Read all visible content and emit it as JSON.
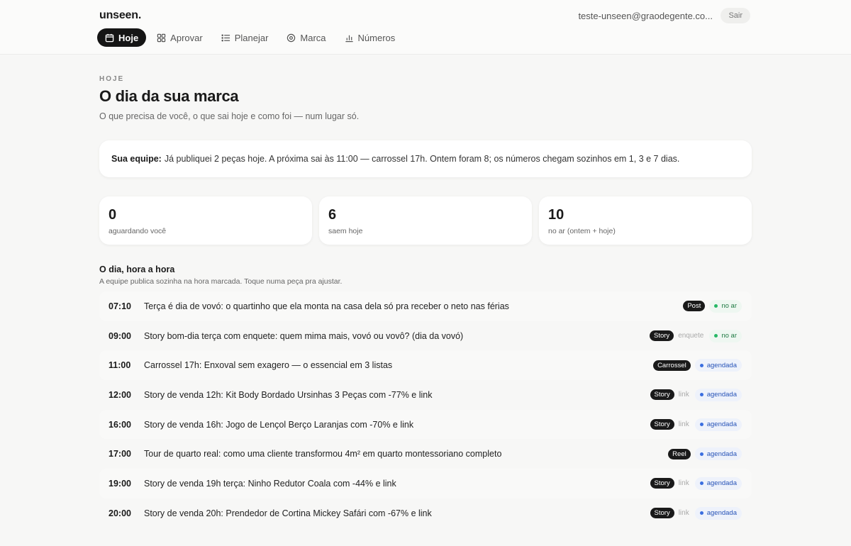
{
  "app": {
    "logo": "unseen.",
    "user_email": "teste-unseen@graodegente.co...",
    "logout_label": "Sair"
  },
  "nav": [
    {
      "label": "Hoje",
      "icon": "calendar-icon",
      "active": true
    },
    {
      "label": "Aprovar",
      "icon": "grid-icon",
      "active": false
    },
    {
      "label": "Planejar",
      "icon": "list-icon",
      "active": false
    },
    {
      "label": "Marca",
      "icon": "target-icon",
      "active": false
    },
    {
      "label": "Números",
      "icon": "bar-chart-icon",
      "active": false
    }
  ],
  "page": {
    "eyebrow": "HOJE",
    "title": "O dia da sua marca",
    "subtitle": "O que precisa de você, o que sai hoje e como foi — num lugar só."
  },
  "team": {
    "label": "Sua equipe:",
    "message": "Já publiquei 2 peças hoje. A próxima sai às 11:00 — carrossel 17h. Ontem foram 8; os números chegam sozinhos em 1, 3 e 7 dias."
  },
  "stats": [
    {
      "value": "0",
      "label": "aguardando você"
    },
    {
      "value": "6",
      "label": "saem hoje"
    },
    {
      "value": "10",
      "label": "no ar (ontem + hoje)"
    }
  ],
  "schedule": {
    "title": "O dia, hora a hora",
    "subtitle": "A equipe publica sozinha na hora marcada. Toque numa peça pra ajustar.",
    "items": [
      {
        "time": "07:10",
        "title": "Terça é dia de vovó: o quartinho que ela monta na casa dela só pra receber o neto nas férias",
        "type": "Post",
        "extra": "",
        "status": "no ar",
        "status_kind": "live"
      },
      {
        "time": "09:00",
        "title": "Story bom-dia terça com enquete: quem mima mais, vovó ou vovô? (dia da vovó)",
        "type": "Story",
        "extra": "enquete",
        "status": "no ar",
        "status_kind": "live"
      },
      {
        "time": "11:00",
        "title": "Carrossel 17h: Enxoval sem exagero — o essencial em 3 listas",
        "type": "Carrossel",
        "extra": "",
        "status": "agendada",
        "status_kind": "sched"
      },
      {
        "time": "12:00",
        "title": "Story de venda 12h: Kit Body Bordado Ursinhas 3 Peças com -77% e link",
        "type": "Story",
        "extra": "link",
        "status": "agendada",
        "status_kind": "sched"
      },
      {
        "time": "16:00",
        "title": "Story de venda 16h: Jogo de Lençol Berço Laranjas com -70% e link",
        "type": "Story",
        "extra": "link",
        "status": "agendada",
        "status_kind": "sched"
      },
      {
        "time": "17:00",
        "title": "Tour de quarto real: como uma cliente transformou 4m² em quarto montessoriano completo",
        "type": "Reel",
        "extra": "",
        "status": "agendada",
        "status_kind": "sched"
      },
      {
        "time": "19:00",
        "title": "Story de venda 19h terça: Ninho Redutor Coala com -44% e link",
        "type": "Story",
        "extra": "link",
        "status": "agendada",
        "status_kind": "sched"
      },
      {
        "time": "20:00",
        "title": "Story de venda 20h: Prendedor de Cortina Mickey Safári com -67% e link",
        "type": "Story",
        "extra": "link",
        "status": "agendada",
        "status_kind": "sched"
      }
    ]
  }
}
